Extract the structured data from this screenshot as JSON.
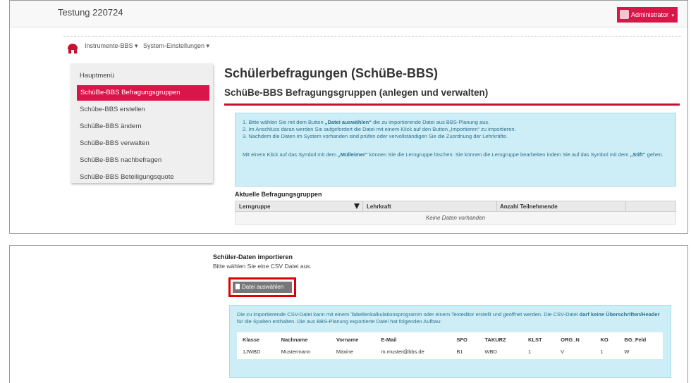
{
  "app": {
    "title": "Testung 220724",
    "user_button": "Administrator"
  },
  "nav": {
    "items": [
      "Instrumente-BBS",
      "System-Einstellungen"
    ]
  },
  "sidebar": {
    "items": [
      {
        "label": "Hauptmenü"
      },
      {
        "label": "SchüBe-BBS Befragungsgruppen"
      },
      {
        "label": "Schübe-BBS erstellen"
      },
      {
        "label": "SchüBe-BBS ändern"
      },
      {
        "label": "SchüBe-BBS verwalten"
      },
      {
        "label": "SchüBe-BBS nachbefragen"
      },
      {
        "label": "SchüBe-BBS Beteiligungsquote"
      }
    ]
  },
  "main": {
    "title": "Schülerbefragungen (SchüBe-BBS)",
    "subtitle": "SchüBe-BBS Befragungsgruppen (anlegen und verwalten)",
    "info": {
      "line1_pre": "1. Bitte wählen Sie mit dem Button ",
      "line1_bold": "„Datei auswählen“",
      "line1_post": " die zu importierende Datei aus BBS-Planung aus.",
      "line2": "2. Im Anschluss daran werden Sie aufgefordert die Datei mit einem Klick auf den Button „Importieren“ zu importieren.",
      "line3": "3. Nachdem die Daten im System vorhanden sind prüfen oder vervollständigen Sie die Zuordnung der Lehrkräfte.",
      "para_pre": "Mit einem Klick auf das Symbol mit dem ",
      "para_bold1": "„Mülleimer“",
      "para_mid": " können Sie die Lerngruppe löschen. Sie können die Lerngruppe bearbeiten indem Sie auf das Symbol mit dem ",
      "para_bold2": "„Stift“",
      "para_post": " gehen."
    },
    "groups_title": "Aktuelle Befragungsgruppen",
    "groups_columns": [
      "Lerngruppe",
      "Lehrkraft",
      "Anzahl Teilnehmende"
    ],
    "groups_empty": "Keine Daten vorhanden"
  },
  "import": {
    "title": "Schüler-Daten importieren",
    "subtitle": "Bitte wählen Sie eine CSV Datei aus.",
    "button": "Datei auswählen",
    "info_pre": "Die zu importierende CSV-Datei kann mit einem Tabellenkalkulationsprogramm oder einem Texteditor erstellt und geoffnet werden. Die CSV-Datei ",
    "info_bold": "darf keine Überschriften/Header",
    "info_post": " für die Spalten enthalten. Die aus BBS-Planung exportierte Datei hat folgenden Aufbau:",
    "columns": [
      "Klasse",
      "Nachname",
      "Vorname",
      "E-Mail",
      "SFO",
      "TAKURZ",
      "KLST",
      "ORG_N",
      "KO",
      "BG_Feld"
    ],
    "row": [
      "1JWBD",
      "Mustermann",
      "Maxine",
      "m.muster@bbs.de",
      "B1",
      "WBD",
      "1",
      "V",
      "1",
      "W"
    ]
  }
}
